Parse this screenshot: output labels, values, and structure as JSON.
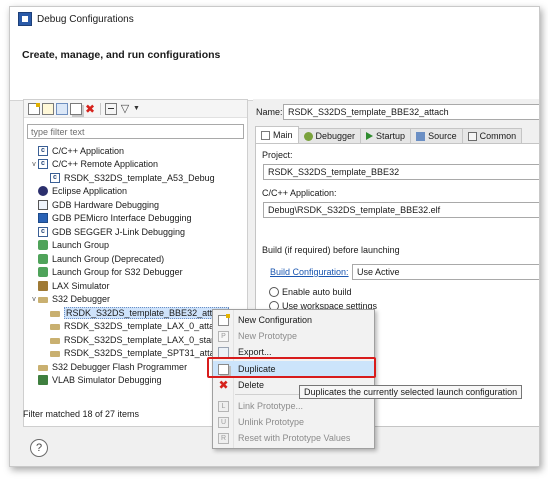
{
  "window": {
    "title": "Debug Configurations",
    "banner_title": "Create, manage, and run configurations"
  },
  "left_pane": {
    "filter_placeholder": "type filter text",
    "toolbar_icons": [
      "new-launch-config-icon",
      "new-prototype-icon",
      "export-icon",
      "duplicate-icon",
      "delete-icon",
      "collapse-all-icon",
      "filter-icon",
      "view-menu-icon"
    ],
    "tree": [
      {
        "label": "C/C++ Application",
        "icon": "c-config-icon",
        "level": 1,
        "expander": ""
      },
      {
        "label": "C/C++ Remote Application",
        "icon": "c-config-icon",
        "level": 1,
        "expander": "v"
      },
      {
        "label": "RSDK_S32DS_template_A53_Debug",
        "icon": "c-config-icon",
        "level": 2,
        "expander": ""
      },
      {
        "label": "Eclipse Application",
        "icon": "eclipse-icon",
        "level": 1,
        "expander": ""
      },
      {
        "label": "GDB Hardware Debugging",
        "icon": "gdb-icon",
        "level": 1,
        "expander": ""
      },
      {
        "label": "GDB PEMicro Interface Debugging",
        "icon": "pe-icon",
        "level": 1,
        "expander": ""
      },
      {
        "label": "GDB SEGGER J-Link Debugging",
        "icon": "c-config-icon",
        "level": 1,
        "expander": ""
      },
      {
        "label": "Launch Group",
        "icon": "launch-group-icon",
        "level": 1,
        "expander": ""
      },
      {
        "label": "Launch Group (Deprecated)",
        "icon": "launch-group-icon",
        "level": 1,
        "expander": ""
      },
      {
        "label": "Launch Group for S32 Debugger",
        "icon": "launch-group-icon",
        "level": 1,
        "expander": ""
      },
      {
        "label": "LAX Simulator",
        "icon": "lax-icon",
        "level": 1,
        "expander": ""
      },
      {
        "label": "S32 Debugger",
        "icon": "s32-debugger-icon",
        "level": 1,
        "expander": "v"
      },
      {
        "label": "RSDK_S32DS_template_BBE32_attach",
        "icon": "s32-debugger-icon",
        "level": 2,
        "expander": "",
        "selected": true
      },
      {
        "label": "RSDK_S32DS_template_LAX_0_attach",
        "icon": "s32-debugger-icon",
        "level": 2,
        "expander": ""
      },
      {
        "label": "RSDK_S32DS_template_LAX_0_standa",
        "icon": "s32-debugger-icon",
        "level": 2,
        "expander": ""
      },
      {
        "label": "RSDK_S32DS_template_SPT31_attach",
        "icon": "s32-debugger-icon",
        "level": 2,
        "expander": ""
      },
      {
        "label": "S32 Debugger Flash Programmer",
        "icon": "s32-debugger-icon",
        "level": 1,
        "expander": ""
      },
      {
        "label": "VLAB Simulator Debugging",
        "icon": "vlab-icon",
        "level": 1,
        "expander": ""
      }
    ],
    "status": "Filter matched 18 of 27 items"
  },
  "right_pane": {
    "name_label": "Name:",
    "name_value": "RSDK_S32DS_template_BBE32_attach",
    "tabs": [
      {
        "label": "Main",
        "icon": "main-tab-icon",
        "active": true
      },
      {
        "label": "Debugger",
        "icon": "debugger-tab-icon",
        "active": false
      },
      {
        "label": "Startup",
        "icon": "startup-tab-icon",
        "active": false
      },
      {
        "label": "Source",
        "icon": "source-tab-icon",
        "active": false
      },
      {
        "label": "Common",
        "icon": "common-tab-icon",
        "active": false
      }
    ],
    "project_label": "Project:",
    "project_value": "RSDK_S32DS_template_BBE32",
    "app_label": "C/C++ Application:",
    "app_value": "Debug\\RSDK_S32DS_template_BBE32.elf",
    "build_group_label": "Build (if required) before launching",
    "build_config_link": "Build Configuration:",
    "build_config_value": "Use Active",
    "radio_auto_build": "Enable auto build",
    "radio_workspace": "Use workspace settings"
  },
  "context_menu": {
    "items": [
      {
        "label": "New Configuration",
        "icon": "new-configuration-icon",
        "disabled": false
      },
      {
        "label": "New Prototype",
        "icon": "new-prototype-icon",
        "disabled": true
      },
      {
        "label": "Export...",
        "icon": "export-icon",
        "disabled": false
      },
      {
        "label": "Duplicate",
        "icon": "duplicate-icon",
        "disabled": false,
        "hovered": true
      },
      {
        "label": "Delete",
        "icon": "delete-icon",
        "disabled": false
      },
      {
        "label": "Link Prototype...",
        "icon": "link-prototype-icon",
        "disabled": true
      },
      {
        "label": "Unlink Prototype",
        "icon": "unlink-prototype-icon",
        "disabled": true
      },
      {
        "label": "Reset with Prototype Values",
        "icon": "reset-prototype-icon",
        "disabled": true
      }
    ],
    "tooltip": "Duplicates the currently selected launch configuration"
  },
  "colors": {
    "highlight_border": "#d81c1c",
    "hover_fill": "#cce4fb",
    "link": "#1a56b0"
  }
}
